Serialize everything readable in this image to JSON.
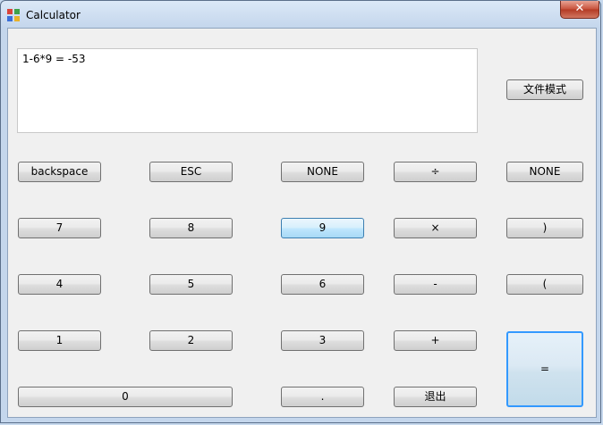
{
  "window": {
    "title": "Calculator",
    "close_label": "✕"
  },
  "display": {
    "expression": "1-6*9 = -53"
  },
  "buttons": {
    "file_mode": "文件模式",
    "backspace": "backspace",
    "esc": "ESC",
    "none_1": "NONE",
    "divide": "÷",
    "none_2": "NONE",
    "seven": "7",
    "eight": "8",
    "nine": "9",
    "multiply": "×",
    "right_paren": ")",
    "four": "4",
    "five": "5",
    "six": "6",
    "minus": "-",
    "left_paren": "(",
    "one": "1",
    "two": "2",
    "three": "3",
    "plus": "+",
    "equals": "=",
    "zero": "0",
    "dot": ".",
    "exit": "退出"
  }
}
